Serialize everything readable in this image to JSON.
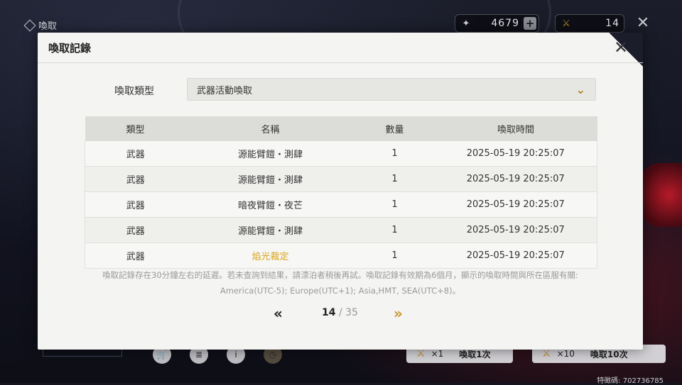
{
  "topbar": {
    "title": "喚取",
    "currency1": {
      "icon": "star-crystal-icon",
      "value": "4679",
      "plus": "+"
    },
    "currency2": {
      "icon": "sword-ticket-icon",
      "value": "14"
    },
    "close": "✕"
  },
  "modal": {
    "title": "喚取記錄",
    "filter_label": "喚取類型",
    "filter_value": "武器活動喚取",
    "columns": [
      "類型",
      "名稱",
      "數量",
      "喚取時間"
    ],
    "rows": [
      {
        "type": "武器",
        "name": "源能臂鎧・測肆",
        "qty": "1",
        "time": "2025-05-19 20:25:07",
        "highlight": false
      },
      {
        "type": "武器",
        "name": "源能臂鎧・測肆",
        "qty": "1",
        "time": "2025-05-19 20:25:07",
        "highlight": false
      },
      {
        "type": "武器",
        "name": "暗夜臂鎧・夜芒",
        "qty": "1",
        "time": "2025-05-19 20:25:07",
        "highlight": false
      },
      {
        "type": "武器",
        "name": "源能臂鎧・測肆",
        "qty": "1",
        "time": "2025-05-19 20:25:07",
        "highlight": false
      },
      {
        "type": "武器",
        "name": "焰光裁定",
        "qty": "1",
        "time": "2025-05-19 20:25:07",
        "highlight": true
      }
    ],
    "note_line1": "喚取記錄存在30分鐘左右的延遲。若未查詢到結果，請漂泊者稍後再試。喚取記錄有效期為6個月，顯示的喚取時間與所在區服有關:",
    "note_line2": "America(UTC-5); Europe(UTC+1); Asia,HMT, SEA(UTC+8)。",
    "pager": {
      "current": "14",
      "separator": "/",
      "total": "35"
    }
  },
  "bottom": {
    "pull1": {
      "count": "×1",
      "label": "喚取1次"
    },
    "pull2": {
      "count": "×10",
      "label": "喚取10次"
    },
    "uid": "特徵碼: 702736785"
  },
  "colors": {
    "accent_gold": "#c9962c",
    "highlight_text": "#d9a21c",
    "modal_bg": "#f4f4f2"
  }
}
